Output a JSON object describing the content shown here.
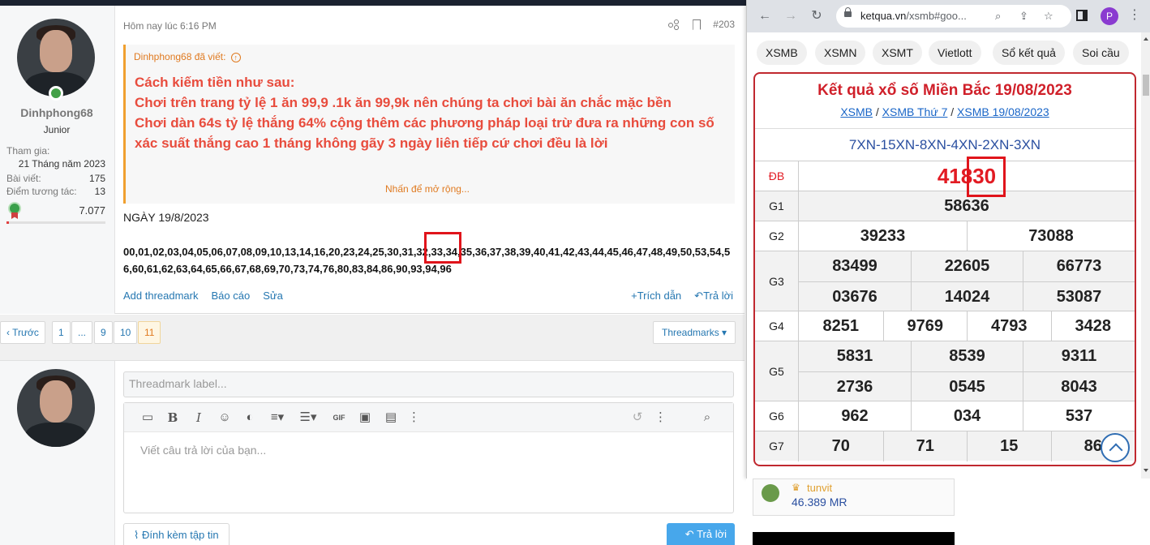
{
  "forum": {
    "post": {
      "user": {
        "name": "Dinhphong68",
        "role": "Junior",
        "stats": [
          {
            "label": "Tham gia:",
            "value": "21 Tháng năm 2023"
          },
          {
            "label": "Bài viết:",
            "value": "175"
          },
          {
            "label": "Điểm tương tác:",
            "value": "13"
          }
        ],
        "points": "7.077"
      },
      "time": "Hôm nay lúc 6:16 PM",
      "post_number": "#203",
      "quote": {
        "author": "Dinhphong68 đã viết:",
        "lines": [
          "Cách kiếm tiền như sau:",
          "Chơi trên trang tỷ lệ 1 ăn 99,9 .1k ăn 99,9k nên chúng ta chơi bài ăn chắc mặc bền",
          "Chơi dàn 64s tỷ lệ thắng 64% cộng thêm các phương pháp loại trừ đưa ra những con số xác suất thắng cao 1 tháng không gãy 3 ngày liên tiếp cứ chơi đều là lời"
        ],
        "expand": "Nhấn để mở rộng..."
      },
      "date_line": "NGÀY 19/8/2023",
      "numbers": "00,01,02,03,04,05,06,07,08,09,10,13,14,16,20,23,24,25,30,31,32,33,34,35,36,37,38,39,40,41,42,43,44,45,46,47,48,49,50,53,54,56,60,61,62,63,64,65,66,67,68,69,70,73,74,76,80,83,84,86,90,93,94,96",
      "actions": {
        "threadmark": "Add threadmark",
        "report": "Báo cáo",
        "edit": "Sửa",
        "quote": "Trích dẫn",
        "reply": "Trả lời"
      }
    },
    "pager": {
      "prev": "Trước",
      "pages": [
        "1",
        "...",
        "9",
        "10",
        "11"
      ],
      "current": "11",
      "threadmarks": "Threadmarks"
    },
    "reply": {
      "threadmark_placeholder": "Threadmark label...",
      "editor_placeholder": "Viết câu trả lời của bạn...",
      "attach": "Đính kèm tập tin",
      "submit": "Trả lời"
    }
  },
  "browser": {
    "url_host": "ketqua.vn",
    "url_path": "/xsmb#goo...",
    "profile_letter": "P",
    "chips": [
      "XSMB",
      "XSMN",
      "XSMT",
      "Vietlott",
      "Sổ kết quả",
      "Soi cầu"
    ],
    "result": {
      "title": "Kết quả xổ số Miền Bắc 19/08/2023",
      "links": [
        "XSMB",
        "XSMB Thứ 7",
        "XSMB 19/08/2023"
      ],
      "link_sep": " / ",
      "code": "7XN-15XN-8XN-4XN-2XN-3XN",
      "rows": [
        {
          "label": "ĐB",
          "values": [
            "41830"
          ]
        },
        {
          "label": "G1",
          "values": [
            "58636"
          ]
        },
        {
          "label": "G2",
          "values": [
            "39233",
            "73088"
          ]
        },
        {
          "label": "G3",
          "values": [
            "83499",
            "22605",
            "66773",
            "03676",
            "14024",
            "53087"
          ]
        },
        {
          "label": "G4",
          "values": [
            "8251",
            "9769",
            "4793",
            "3428"
          ]
        },
        {
          "label": "G5",
          "values": [
            "5831",
            "8539",
            "9311",
            "2736",
            "0545",
            "8043"
          ]
        },
        {
          "label": "G6",
          "values": [
            "962",
            "034",
            "537"
          ]
        },
        {
          "label": "G7",
          "values": [
            "70",
            "71",
            "15",
            "86"
          ]
        }
      ]
    }
  },
  "sidebar_widget": {
    "name": "tunvit",
    "value": "46.389 MR"
  },
  "colors": {
    "accent_red": "#e0141b",
    "quote_text": "#e84c3d",
    "link_blue": "#2577b1",
    "result_title": "#d0202a"
  }
}
